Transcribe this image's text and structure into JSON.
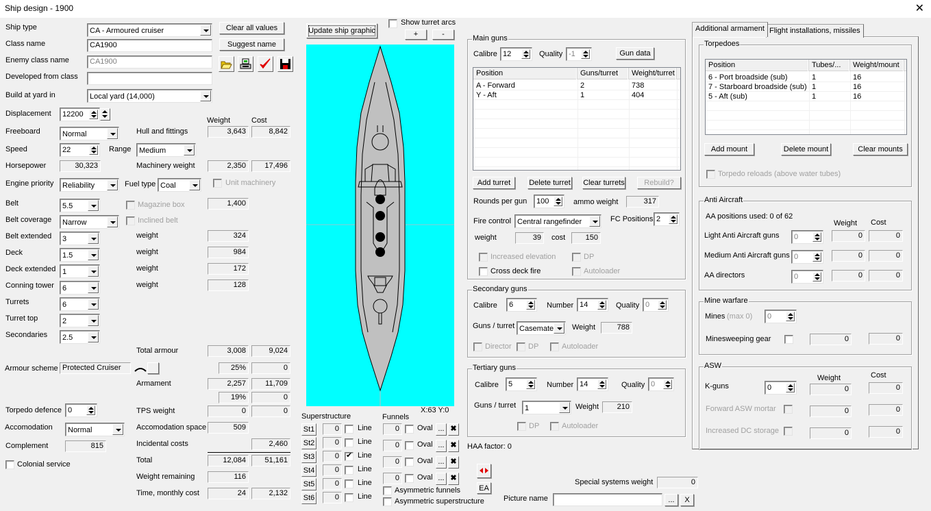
{
  "window": {
    "title": "Ship design - 1900",
    "close_glyph": "✕"
  },
  "general": {
    "ship_type_label": "Ship type",
    "ship_type": "CA - Armoured cruiser",
    "class_name_label": "Class name",
    "class_name": "CA1900",
    "enemy_class_label": "Enemy class name",
    "enemy_class": "CA1900",
    "developed_from_label": "Developed from class",
    "developed_from": "",
    "build_yard_label": "Build at yard in",
    "build_yard": "Local yard (14,000)",
    "clear_all_label": "Clear all values",
    "suggest_name_label": "Suggest name"
  },
  "icons": {
    "open": "folder-open-icon",
    "print": "printer-icon",
    "check": "checkmark-icon",
    "save": "floppy-disk-icon"
  },
  "specs": {
    "displacement_label": "Displacement",
    "displacement": "12200",
    "freeboard_label": "Freeboard",
    "freeboard": "Normal",
    "speed_label": "Speed",
    "speed": "22",
    "range_label": "Range",
    "range": "Medium",
    "horsepower_label": "Horsepower",
    "horsepower": "30,323",
    "engine_priority_label": "Engine priority",
    "engine_priority": "Reliability",
    "fuel_type_label": "Fuel type",
    "fuel_type": "Coal",
    "unit_machinery_label": "Unit machinery"
  },
  "armour": {
    "belt_label": "Belt",
    "belt": "5.5",
    "belt_coverage_label": "Belt coverage",
    "belt_coverage": "Narrow",
    "belt_extended_label": "Belt extended",
    "belt_extended": "3",
    "deck_label": "Deck",
    "deck": "1.5",
    "deck_extended_label": "Deck extended",
    "deck_extended": "1",
    "conning_tower_label": "Conning tower",
    "conning_tower": "6",
    "turrets_label": "Turrets",
    "turrets": "6",
    "turret_top_label": "Turret top",
    "turret_top": "2",
    "secondaries_label": "Secondaries",
    "secondaries": "2.5",
    "magazine_box_label": "Magazine box",
    "inclined_belt_label": "Inclined belt",
    "weight_label": "weight",
    "magazine_weight": "1,400",
    "belt_ext_weight": "324",
    "deck_weight": "984",
    "deck_ext_weight": "172",
    "ct_weight": "128",
    "scheme_label": "Armour scheme",
    "scheme": "Protected Cruiser"
  },
  "weights": {
    "weight_header": "Weight",
    "cost_header": "Cost",
    "hull_label": "Hull and fittings",
    "hull_weight": "3,643",
    "hull_cost": "8,842",
    "machinery_label": "Machinery weight",
    "machinery_weight": "2,350",
    "machinery_cost": "17,496",
    "total_armour_label": "Total armour",
    "total_armour_weight": "3,008",
    "total_armour_cost": "9,024",
    "armour_pct": "25%",
    "armour_pct_cost": "0",
    "armament_label": "Armament",
    "armament_weight": "2,257",
    "armament_cost": "11,709",
    "armament_pct": "19%",
    "armament_pct_cost": "0",
    "tps_label": "TPS weight",
    "tps_weight": "0",
    "tps_cost": "0",
    "accom_space_label": "Accomodation space",
    "accom_space": "509",
    "incidental_label": "Incidental costs",
    "incidental_cost": "2,460",
    "total_label": "Total",
    "total_weight": "12,084",
    "total_cost": "51,161",
    "remaining_label": "Weight remaining",
    "remaining": "116",
    "time_label": "Time, monthly cost",
    "time": "24",
    "monthly_cost": "2,132"
  },
  "crew": {
    "torpedo_defence_label": "Torpedo defence",
    "torpedo_defence": "0",
    "accomodation_label": "Accomodation",
    "accomodation": "Normal",
    "complement_label": "Complement",
    "complement": "815",
    "colonial_label": "Colonial service"
  },
  "graphic": {
    "update_label": "Update ship graphic",
    "show_arcs_label": "Show turret arcs",
    "zoom_in": "+",
    "zoom_out": "-",
    "coords": "X:63 Y:0",
    "water_color": "#00ffff",
    "hull_color": "#c0c0c0"
  },
  "superstructure": {
    "label": "Superstructure",
    "rows": [
      {
        "btn": "St1",
        "value": "0",
        "checked": false,
        "line": "Line"
      },
      {
        "btn": "St2",
        "value": "0",
        "checked": false,
        "line": "Line"
      },
      {
        "btn": "St3",
        "value": "0",
        "checked": true,
        "line": "Line"
      },
      {
        "btn": "St4",
        "value": "0",
        "checked": false,
        "line": "Line"
      },
      {
        "btn": "St5",
        "value": "0",
        "checked": false,
        "line": "Line"
      },
      {
        "btn": "St6",
        "value": "0",
        "checked": false,
        "line": "Line"
      }
    ]
  },
  "funnels": {
    "label": "Funnels",
    "rows": [
      {
        "value": "0",
        "oval": "Oval",
        "browse": "...",
        "clear": "✖"
      },
      {
        "value": "0",
        "oval": "Oval",
        "browse": "...",
        "clear": "✖"
      },
      {
        "value": "0",
        "oval": "Oval",
        "browse": "...",
        "clear": "✖"
      },
      {
        "value": "0",
        "oval": "Oval",
        "browse": "...",
        "clear": "✖"
      }
    ],
    "asym_funnels_label": "Asymmetric funnels",
    "asym_super_label": "Asymmetric superstructure"
  },
  "main_guns": {
    "title": "Main guns",
    "calibre_label": "Calibre",
    "calibre": "12",
    "quality_label": "Quality",
    "quality": "-1",
    "gun_data_label": "Gun data",
    "columns": [
      "Position",
      "Guns/turret",
      "Weight/turret"
    ],
    "rows": [
      [
        "A - Forward",
        "2",
        "738"
      ],
      [
        "Y - Aft",
        "1",
        "404"
      ]
    ],
    "add_turret": "Add turret",
    "delete_turret": "Delete turret",
    "clear_turrets": "Clear turrets",
    "rebuild": "Rebuild?",
    "rounds_label": "Rounds per gun",
    "rounds": "100",
    "ammo_label": "ammo weight",
    "ammo_weight": "317",
    "fc_label": "Fire control",
    "fc": "Central rangefinder",
    "fc_pos_label": "FC Positions",
    "fc_pos": "2",
    "weight_label": "weight",
    "fc_weight": "39",
    "cost_label": "cost",
    "fc_cost": "150",
    "incr_elev_label": "Increased elevation",
    "dp_label": "DP",
    "cross_deck_label": "Cross deck fire",
    "autoloader_label": "Autoloader"
  },
  "secondary_guns": {
    "title": "Secondary guns",
    "calibre_label": "Calibre",
    "calibre": "6",
    "number_label": "Number",
    "number": "14",
    "quality_label": "Quality",
    "quality": "0",
    "gpt_label": "Guns / turret",
    "gpt": "Casemates",
    "weight_label": "Weight",
    "weight": "788",
    "director_label": "Director",
    "dp_label": "DP",
    "autoloader_label": "Autoloader"
  },
  "tertiary_guns": {
    "title": "Tertiary guns",
    "calibre_label": "Calibre",
    "calibre": "5",
    "number_label": "Number",
    "number": "14",
    "quality_label": "Quality",
    "quality": "0",
    "gpt_label": "Guns / turret",
    "gpt": "1",
    "weight_label": "Weight",
    "weight": "210",
    "dp_label": "DP",
    "autoloader_label": "Autoloader"
  },
  "misc": {
    "haa_label": "HAA factor: 0",
    "ea_label": "EA",
    "arrows_icon": "left-right-arrows-icon",
    "special_label": "Special systems weight",
    "special_weight": "0",
    "picture_label": "Picture name",
    "picture_name": "",
    "browse": "...",
    "clear": "X"
  },
  "tabs": [
    {
      "label": "Additional armament",
      "active": true
    },
    {
      "label": "Flight installations, missiles",
      "active": false
    }
  ],
  "torpedoes": {
    "title": "Torpedoes",
    "columns": [
      "Position",
      "Tubes/...",
      "Weight/mount"
    ],
    "rows": [
      [
        "6 - Port broadside (sub)",
        "1",
        "16"
      ],
      [
        "7 - Starboard broadside (sub)",
        "1",
        "16"
      ],
      [
        "5 - Aft (sub)",
        "1",
        "16"
      ]
    ],
    "add_mount": "Add mount",
    "delete_mount": "Delete mount",
    "clear_mounts": "Clear mounts",
    "reloads_label": "Torpedo reloads (above water tubes)"
  },
  "anti_aircraft": {
    "title": "Anti Aircraft",
    "positions_used": "AA positions used: 0 of 62",
    "weight_header": "Weight",
    "cost_header": "Cost",
    "rows": [
      {
        "label": "Light Anti Aircraft guns",
        "value": "0",
        "weight": "0",
        "cost": "0"
      },
      {
        "label": "Medium Anti Aircraft guns",
        "value": "0",
        "weight": "0",
        "cost": "0"
      },
      {
        "label": "AA directors",
        "value": "0",
        "weight": "0",
        "cost": "0"
      }
    ]
  },
  "mine_warfare": {
    "title": "Mine warfare",
    "mines_label": "Mines",
    "mines_max": "(max 0)",
    "mines": "0",
    "sweeping_label": "Minesweeping gear",
    "sweeping_weight": "0",
    "sweeping_cost": "0"
  },
  "asw": {
    "title": "ASW",
    "weight_header": "Weight",
    "cost_header": "Cost",
    "kguns_label": "K-guns",
    "kguns": "0",
    "kguns_weight": "0",
    "kguns_cost": "0",
    "mortar_label": "Forward ASW mortar",
    "mortar_weight": "0",
    "mortar_cost": "0",
    "dc_label": "Increased DC storage",
    "dc_weight": "0",
    "dc_cost": "0"
  }
}
